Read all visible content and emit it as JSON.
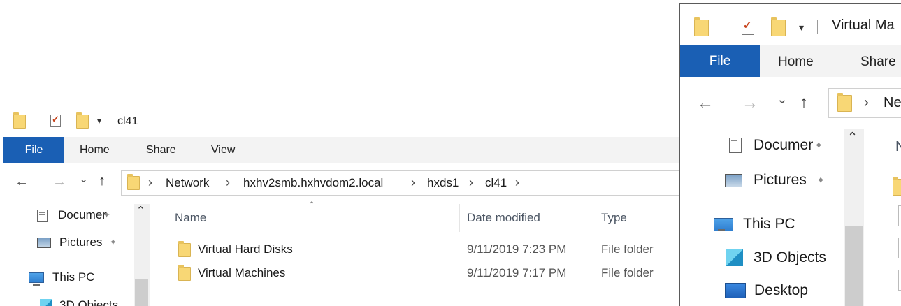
{
  "window_left": {
    "title": "cl41",
    "ribbon": {
      "file": "File",
      "home": "Home",
      "share": "Share",
      "view": "View"
    },
    "address": [
      "Network",
      "hxhv2smb.hxhvdom2.local",
      "hxds1",
      "cl41"
    ],
    "sidebar": [
      {
        "label": "Documer",
        "icon": "document-icon",
        "pinned": true
      },
      {
        "label": "Pictures",
        "icon": "pictures-icon",
        "pinned": true
      },
      {
        "label": "This PC",
        "icon": "pc-icon"
      },
      {
        "label": "3D Objects",
        "icon": "cube-icon"
      }
    ],
    "columns": {
      "name": "Name",
      "date": "Date modified",
      "type": "Type"
    },
    "rows": [
      {
        "name": "Virtual Hard Disks",
        "date": "9/11/2019 7:23 PM",
        "type": "File folder"
      },
      {
        "name": "Virtual Machines",
        "date": "9/11/2019 7:17 PM",
        "type": "File folder"
      }
    ]
  },
  "window_right": {
    "title": "Virtual Ma",
    "ribbon": {
      "file": "File",
      "home": "Home",
      "share": "Share"
    },
    "address": [
      "Ne"
    ],
    "sidebar": [
      {
        "label": "Documer",
        "icon": "document-icon",
        "pinned": true
      },
      {
        "label": "Pictures",
        "icon": "pictures-icon",
        "pinned": true
      },
      {
        "label": "This PC",
        "icon": "pc-icon"
      },
      {
        "label": "3D Objects",
        "icon": "cube-icon"
      },
      {
        "label": "Desktop",
        "icon": "desktop-icon"
      }
    ],
    "columns": {
      "name": "N"
    }
  },
  "glyphs": {
    "back": "←",
    "forward": "→",
    "recent": "⌄",
    "up": "↑",
    "chevron": "›",
    "caret": "⌃",
    "pin": "✦",
    "qa_dropdown": "▾"
  },
  "colors": {
    "file_tab": "#1a5fb4",
    "folder": "#f8d775",
    "ribbon": "#f3f3f3"
  }
}
